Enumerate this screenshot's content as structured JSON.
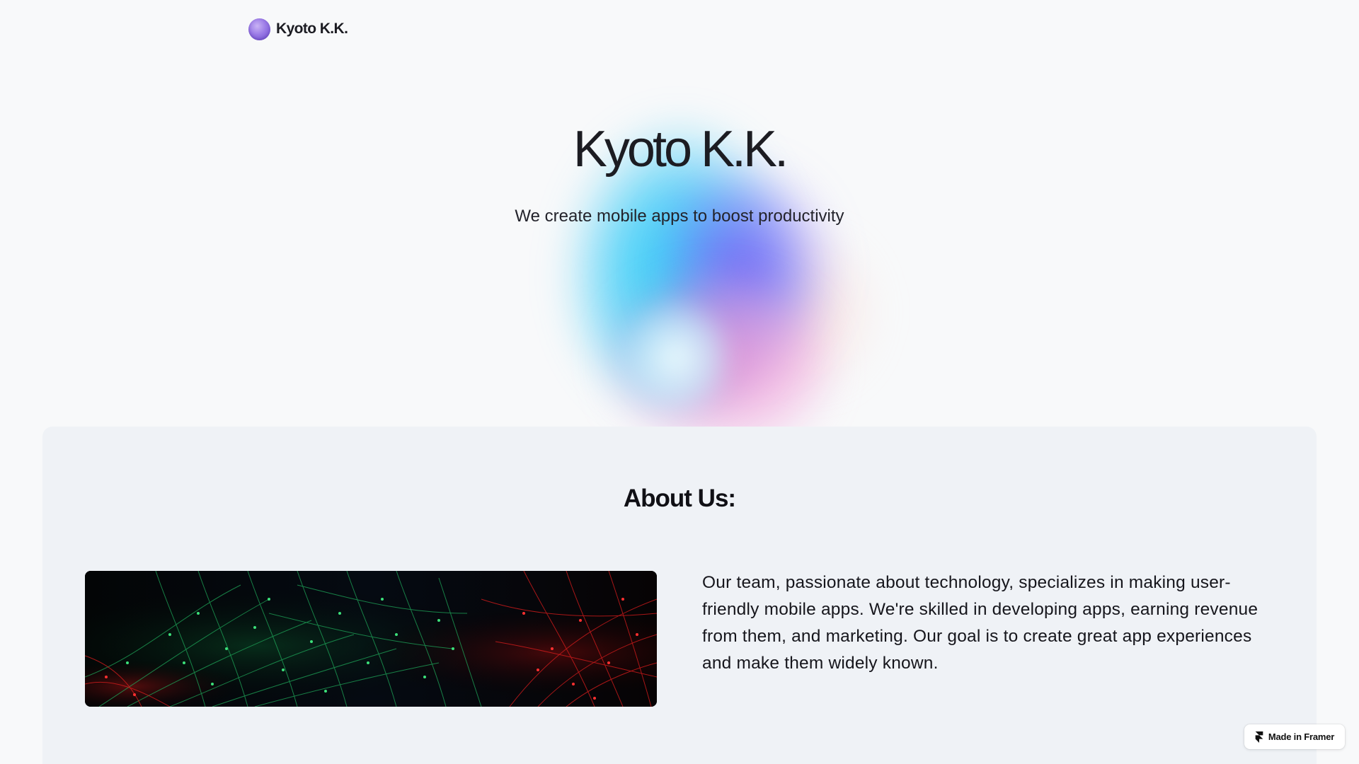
{
  "nav": {
    "brand": "Kyoto K.K."
  },
  "hero": {
    "title": "Kyoto K.K.",
    "subtitle": "We create mobile apps to boost productivity"
  },
  "about": {
    "heading": "About Us:",
    "image_icon": "network-mesh-image",
    "body": "Our team, passionate about technology, specializes in making user-friendly mobile apps. We're skilled in developing apps, earning revenue from them, and marketing. Our goal is to create great app experiences and make them widely known."
  },
  "framer_badge": {
    "label": "Made in Framer",
    "icon": "framer-icon"
  },
  "colors": {
    "background": "#f8f9fa",
    "section": "#eff2f6",
    "text": "#1c1c22",
    "glow_cyan": "#2fd9f7",
    "glow_violet": "#7a60f6",
    "glow_pink": "#f08cd2"
  }
}
